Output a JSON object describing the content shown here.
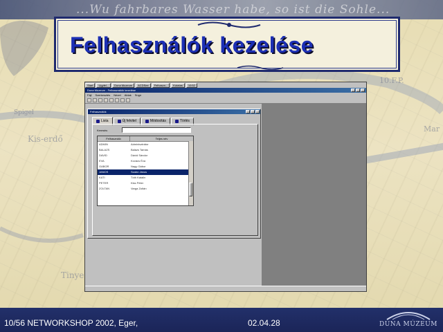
{
  "slide": {
    "title": "Felhasználók kezelése",
    "banner_script": "...Wu fahrbares Wasser habe, so ist die Sohle...",
    "footer_left": "10/56 NETWORKSHOP 2002, Eger,",
    "footer_date": "02.04.28",
    "footer_logo": "DUNA MÚZEUM"
  },
  "screenshot": {
    "taskbar": {
      "start_label": "Start",
      "tasks": [
        "Ugyfel...",
        "Duna Muzeum",
        "ACDSee",
        "Felhaszn...",
        "Kutatas"
      ],
      "clock": "10:52"
    },
    "window_title": "Duna Múzeum - Felhasználók kezelése",
    "menu": [
      "Fájl",
      "Szerkesztés",
      "Nézet",
      "Ablak",
      "Súgó"
    ],
    "dialog": {
      "title": "Felhasználók",
      "tabs": [
        {
          "label": "Lista",
          "active": true
        },
        {
          "label": "Új felvitel",
          "active": false
        },
        {
          "label": "Módosítás",
          "active": false
        },
        {
          "label": "Törlés",
          "active": false
        }
      ],
      "search_label": "Keresés:",
      "search_value": "",
      "columns": [
        "Felhasználó",
        "Teljes név"
      ],
      "rows": [
        {
          "user": "ADMIN",
          "name": "Adminisztrátor",
          "selected": false
        },
        {
          "user": "BALAZS",
          "name": "Balázs Tamás",
          "selected": false
        },
        {
          "user": "DAVID",
          "name": "Dávid Sándor",
          "selected": false
        },
        {
          "user": "EVA",
          "name": "Kovács Éva",
          "selected": false
        },
        {
          "user": "GABOR",
          "name": "Nagy Gábor",
          "selected": false
        },
        {
          "user": "JANOS",
          "name": "Szabó János",
          "selected": true
        },
        {
          "user": "KATI",
          "name": "Tóth Katalin",
          "selected": false
        },
        {
          "user": "PETER",
          "name": "Kiss Péter",
          "selected": false
        },
        {
          "user": "ZOLTAN",
          "name": "Varga Zoltán",
          "selected": false
        }
      ]
    }
  }
}
